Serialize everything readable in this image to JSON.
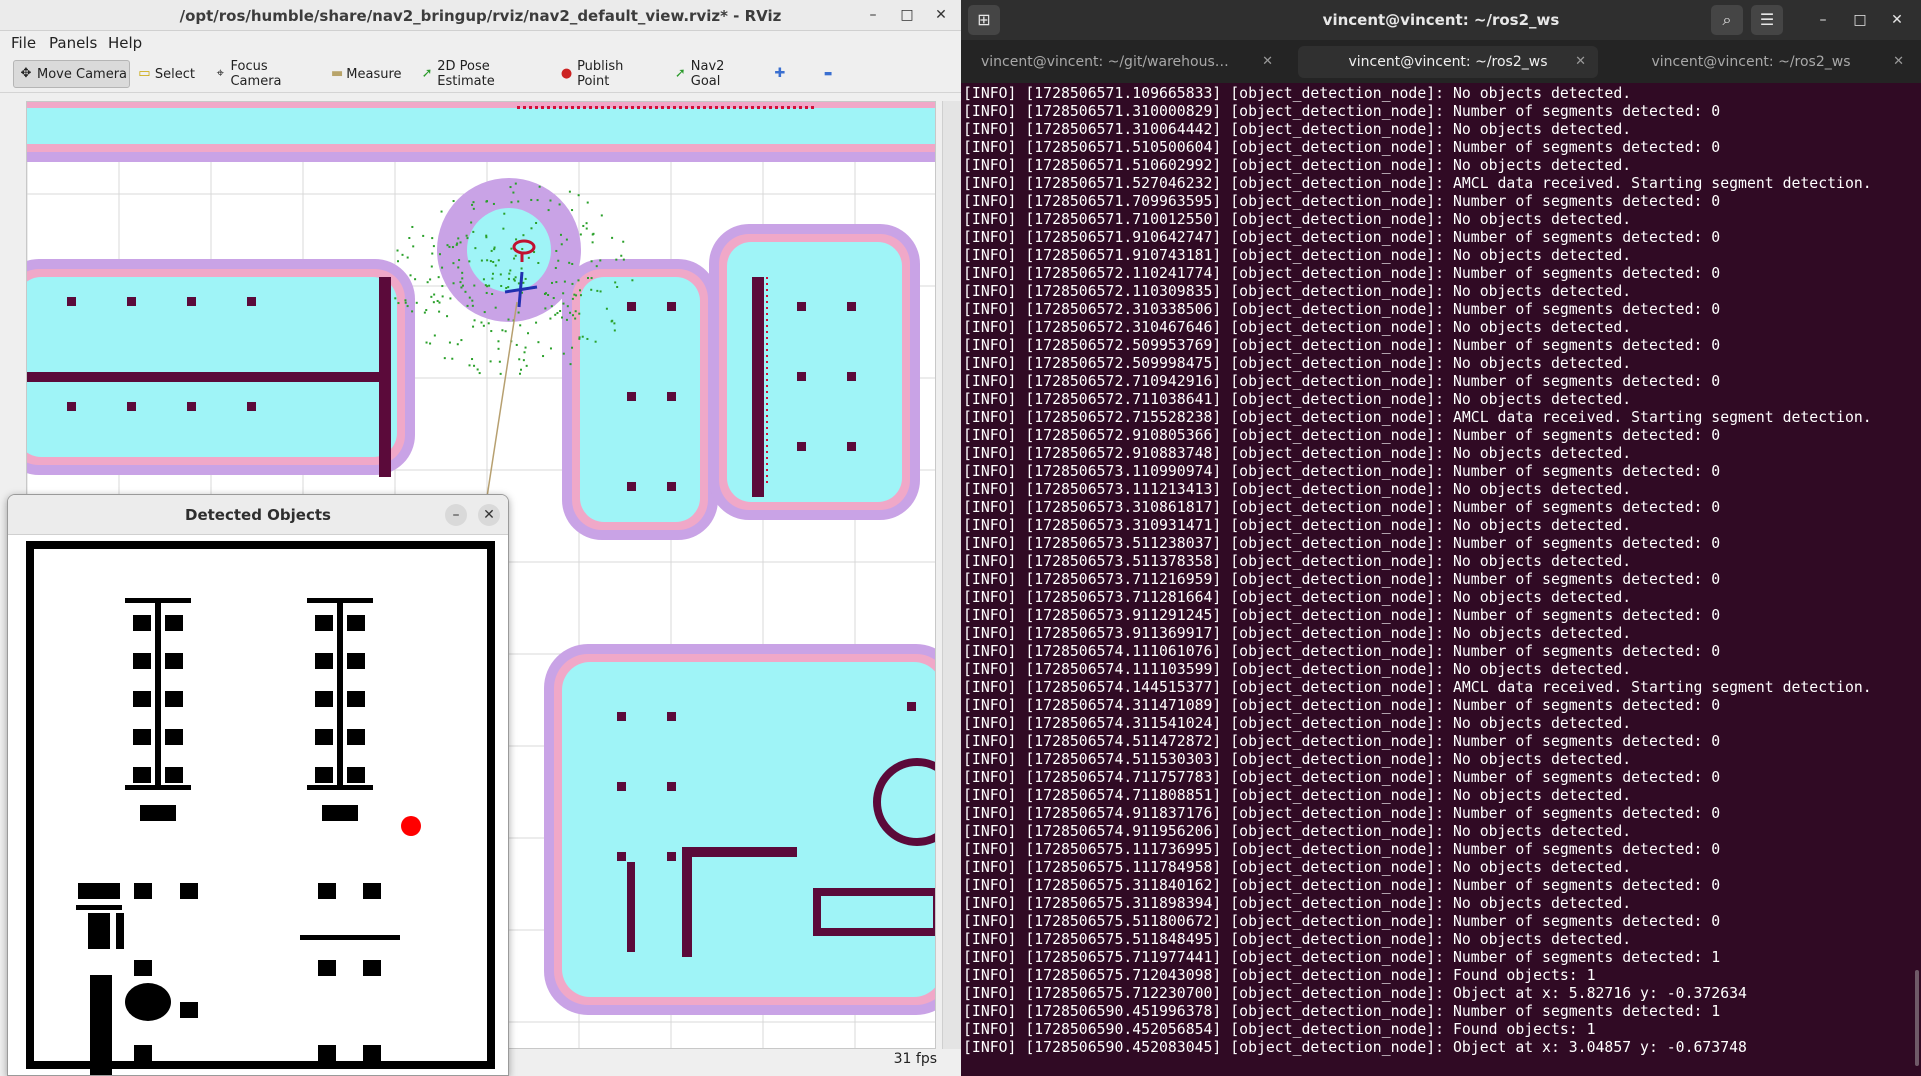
{
  "rviz": {
    "title": "/opt/ros/humble/share/nav2_bringup/rviz/nav2_default_view.rviz* - RViz",
    "controls": {
      "minimize": "–",
      "maximize": "□",
      "close": "✕"
    },
    "menu": [
      "File",
      "Panels",
      "Help"
    ],
    "tools": [
      {
        "label": "Move Camera",
        "icon": "move-camera-icon",
        "glyph": "✥",
        "active": true
      },
      {
        "label": "Select",
        "icon": "select-icon",
        "glyph": "▭"
      },
      {
        "label": "Focus Camera",
        "icon": "focus-camera-icon",
        "glyph": "⌖"
      },
      {
        "label": "Measure",
        "icon": "measure-icon",
        "glyph": "▬"
      },
      {
        "label": "2D Pose Estimate",
        "icon": "pose-estimate-icon",
        "glyph": "➚"
      },
      {
        "label": "Publish Point",
        "icon": "publish-point-icon",
        "glyph": "📍"
      },
      {
        "label": "Nav2 Goal",
        "icon": "nav2-goal-icon",
        "glyph": "➚"
      },
      {
        "label": "",
        "icon": "add-tool-icon",
        "glyph": "✚"
      },
      {
        "label": "",
        "icon": "remove-tool-icon",
        "glyph": "▬"
      }
    ],
    "fps": "31 fps",
    "colors": {
      "free": "#ffffff",
      "inflation": "#c9a3e6",
      "inner": "#9ff4f7",
      "wall": "#5b0a3a",
      "particles": "#2aa02a"
    }
  },
  "detected_objects": {
    "title": "Detected Objects",
    "minimize": "–",
    "close": "✕",
    "marker_color": "#ff0000"
  },
  "terminal": {
    "title": "vincent@vincent: ~/ros2_ws",
    "tabs": [
      {
        "label": "vincent@vincent: ~/git/warehous…",
        "active": false
      },
      {
        "label": "vincent@vincent: ~/ros2_ws",
        "active": true
      },
      {
        "label": "vincent@vincent: ~/ros2_ws",
        "active": false
      }
    ],
    "tab_close": "✕",
    "lines": [
      "[INFO] [1728506571.109665833] [object_detection_node]: No objects detected.",
      "[INFO] [1728506571.310000829] [object_detection_node]: Number of segments detected: 0",
      "[INFO] [1728506571.310064442] [object_detection_node]: No objects detected.",
      "[INFO] [1728506571.510500604] [object_detection_node]: Number of segments detected: 0",
      "[INFO] [1728506571.510602992] [object_detection_node]: No objects detected.",
      "[INFO] [1728506571.527046232] [object_detection_node]: AMCL data received. Starting segment detection.",
      "[INFO] [1728506571.709963595] [object_detection_node]: Number of segments detected: 0",
      "[INFO] [1728506571.710012550] [object_detection_node]: No objects detected.",
      "[INFO] [1728506571.910642747] [object_detection_node]: Number of segments detected: 0",
      "[INFO] [1728506571.910743181] [object_detection_node]: No objects detected.",
      "[INFO] [1728506572.110241774] [object_detection_node]: Number of segments detected: 0",
      "[INFO] [1728506572.110309835] [object_detection_node]: No objects detected.",
      "[INFO] [1728506572.310338506] [object_detection_node]: Number of segments detected: 0",
      "[INFO] [1728506572.310467646] [object_detection_node]: No objects detected.",
      "[INFO] [1728506572.509953769] [object_detection_node]: Number of segments detected: 0",
      "[INFO] [1728506572.509998475] [object_detection_node]: No objects detected.",
      "[INFO] [1728506572.710942916] [object_detection_node]: Number of segments detected: 0",
      "[INFO] [1728506572.711038641] [object_detection_node]: No objects detected.",
      "[INFO] [1728506572.715528238] [object_detection_node]: AMCL data received. Starting segment detection.",
      "[INFO] [1728506572.910805366] [object_detection_node]: Number of segments detected: 0",
      "[INFO] [1728506572.910883748] [object_detection_node]: No objects detected.",
      "[INFO] [1728506573.110990974] [object_detection_node]: Number of segments detected: 0",
      "[INFO] [1728506573.111213413] [object_detection_node]: No objects detected.",
      "[INFO] [1728506573.310861817] [object_detection_node]: Number of segments detected: 0",
      "[INFO] [1728506573.310931471] [object_detection_node]: No objects detected.",
      "[INFO] [1728506573.511238037] [object_detection_node]: Number of segments detected: 0",
      "[INFO] [1728506573.511378358] [object_detection_node]: No objects detected.",
      "[INFO] [1728506573.711216959] [object_detection_node]: Number of segments detected: 0",
      "[INFO] [1728506573.711281664] [object_detection_node]: No objects detected.",
      "[INFO] [1728506573.911291245] [object_detection_node]: Number of segments detected: 0",
      "[INFO] [1728506573.911369917] [object_detection_node]: No objects detected.",
      "[INFO] [1728506574.111061076] [object_detection_node]: Number of segments detected: 0",
      "[INFO] [1728506574.111103599] [object_detection_node]: No objects detected.",
      "[INFO] [1728506574.144515377] [object_detection_node]: AMCL data received. Starting segment detection.",
      "[INFO] [1728506574.311471089] [object_detection_node]: Number of segments detected: 0",
      "[INFO] [1728506574.311541024] [object_detection_node]: No objects detected.",
      "[INFO] [1728506574.511472872] [object_detection_node]: Number of segments detected: 0",
      "[INFO] [1728506574.511530303] [object_detection_node]: No objects detected.",
      "[INFO] [1728506574.711757783] [object_detection_node]: Number of segments detected: 0",
      "[INFO] [1728506574.711808851] [object_detection_node]: No objects detected.",
      "[INFO] [1728506574.911837176] [object_detection_node]: Number of segments detected: 0",
      "[INFO] [1728506574.911956206] [object_detection_node]: No objects detected.",
      "[INFO] [1728506575.111736995] [object_detection_node]: Number of segments detected: 0",
      "[INFO] [1728506575.111784958] [object_detection_node]: No objects detected.",
      "[INFO] [1728506575.311840162] [object_detection_node]: Number of segments detected: 0",
      "[INFO] [1728506575.311898394] [object_detection_node]: No objects detected.",
      "[INFO] [1728506575.511800672] [object_detection_node]: Number of segments detected: 0",
      "[INFO] [1728506575.511848495] [object_detection_node]: No objects detected.",
      "[INFO] [1728506575.711977441] [object_detection_node]: Number of segments detected: 1",
      "[INFO] [1728506575.712043098] [object_detection_node]: Found objects: 1",
      "[INFO] [1728506575.712230700] [object_detection_node]: Object at x: 5.82716 y: -0.372634",
      "[INFO] [1728506590.451996378] [object_detection_node]: Number of segments detected: 1",
      "[INFO] [1728506590.452056854] [object_detection_node]: Found objects: 1",
      "[INFO] [1728506590.452083045] [object_detection_node]: Object at x: 3.04857 y: -0.673748"
    ]
  }
}
